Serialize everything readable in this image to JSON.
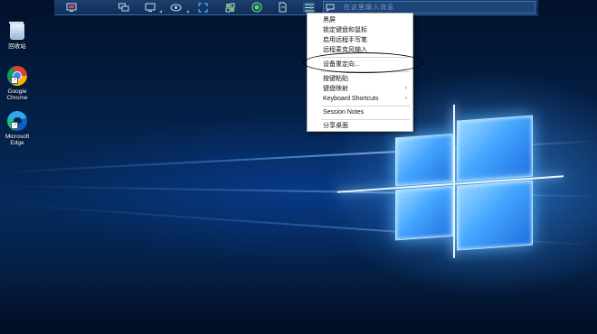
{
  "desktop": {
    "icons": [
      {
        "label": "回收站"
      },
      {
        "label": "Google Chrome"
      },
      {
        "label": "Microsoft Edge"
      }
    ]
  },
  "toolbar": {
    "buttons": [
      "monitor-icon",
      "multi-monitor-icon",
      "display-icon",
      "view-icon",
      "fullscreen-icon",
      "keyboard-icon",
      "record-icon",
      "file-icon",
      "settings-icon"
    ],
    "chat_placeholder": "在这里输入消息"
  },
  "menu": {
    "items": [
      {
        "label": "黑屏"
      },
      {
        "label": "锁定键盘和鼠标"
      },
      {
        "label": "启用远程手写笔"
      },
      {
        "label": "远程麦克风输入"
      },
      {
        "label": "设备重定向..."
      },
      {
        "label": "按键粘贴"
      },
      {
        "label": "键盘映射",
        "submenu": true
      },
      {
        "label": "Keyboard Shortcuts",
        "submenu": true
      },
      {
        "label": "Session Notes"
      },
      {
        "label": "分享桌面"
      }
    ],
    "submenu_arrow": "›"
  },
  "colors": {
    "toolbar_bg": "#102f57",
    "accent": "#46a6ff",
    "annotation": "#000000"
  }
}
